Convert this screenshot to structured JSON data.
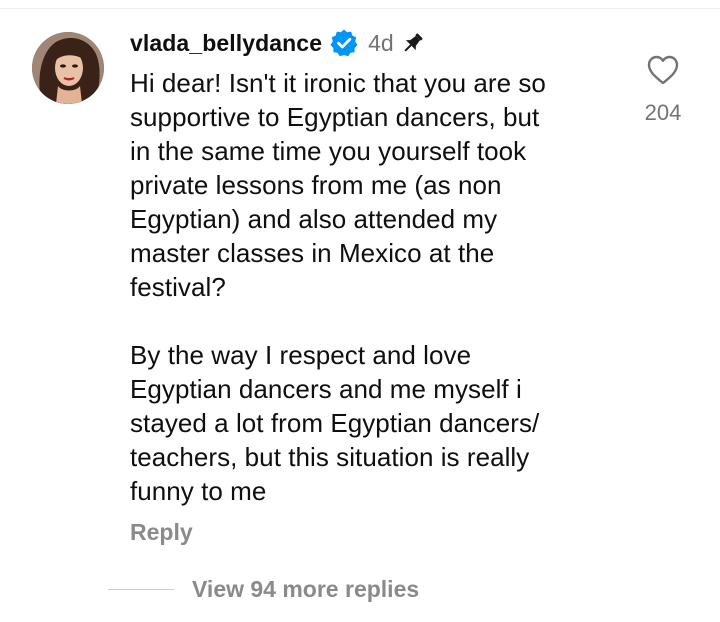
{
  "comment": {
    "username": "vlada_bellydance",
    "time_ago": "4d",
    "text": "Hi dear! Isn't it ironic that you are so\nsupportive to Egyptian dancers, but\nin the same time you yourself took\nprivate lessons from me (as non\nEgyptian) and also attended my\nmaster classes in Mexico at the\nfestival?\n\nBy the way I respect and love\nEgyptian dancers and me myself i\nstayed a lot from Egyptian dancers/\nteachers, but this situation is really\nfunny to me",
    "like_count": "204",
    "reply_label": "Reply",
    "view_replies_label": "View 94 more replies"
  },
  "icons": {
    "verified": "verified-badge-icon",
    "pin": "pin-icon",
    "like": "heart-outline-icon"
  },
  "colors": {
    "text_primary": "#0f0f0f",
    "text_secondary": "#737373",
    "verified_blue": "#0095f6",
    "background": "#ffffff"
  }
}
